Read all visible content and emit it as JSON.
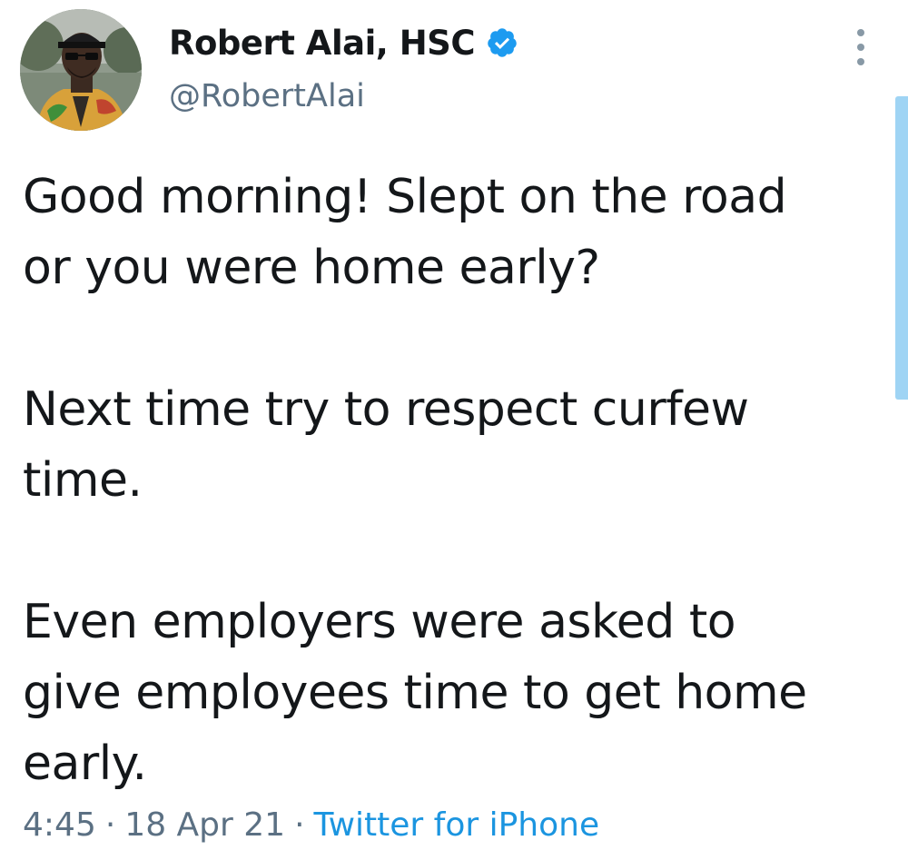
{
  "tweet": {
    "author": {
      "display_name": "Robert Alai, HSC",
      "handle": "@RobertAlai",
      "verified": true,
      "verified_icon": "verified-badge-icon"
    },
    "more_icon": "more-vertical-icon",
    "paragraphs": [
      [
        "Good morning! Slept on the road",
        "or you were home early?"
      ],
      [
        "Next time try to respect curfew",
        "time."
      ],
      [
        "Even employers were asked to",
        "give employees time to get home",
        "early."
      ]
    ],
    "meta": {
      "time": "4:45",
      "date": "18 Apr 21",
      "source": "Twitter for iPhone",
      "separator": "·"
    }
  },
  "colors": {
    "text": "#14171a",
    "secondary": "#5b7083",
    "accent": "#1b95e0",
    "scroll_indicator": "#9fd4f4"
  }
}
